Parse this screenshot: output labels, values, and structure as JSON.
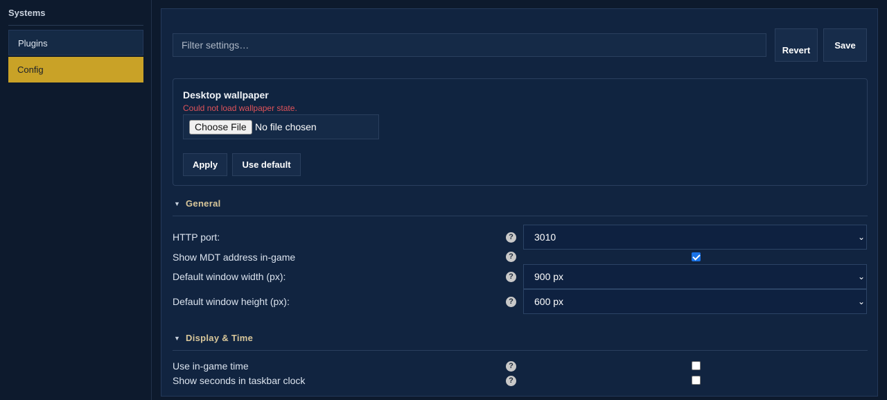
{
  "sidebar": {
    "title": "Systems",
    "items": [
      {
        "label": "Plugins",
        "active": false
      },
      {
        "label": "Config",
        "active": true
      }
    ]
  },
  "toolbar": {
    "filter_placeholder": "Filter settings…",
    "revert_label": "Revert",
    "save_label": "Save"
  },
  "wallpaper": {
    "title": "Desktop wallpaper",
    "error": "Could not load wallpaper state.",
    "choose_file_label": "Choose File",
    "no_file_text": "No file chosen",
    "apply_label": "Apply",
    "use_default_label": "Use default"
  },
  "sections": {
    "general": {
      "title": "General",
      "rows": [
        {
          "label": "HTTP port:",
          "type": "select",
          "value": "3010"
        },
        {
          "label": "Show MDT address in-game",
          "type": "checkbox",
          "checked": true
        },
        {
          "label": "Default window width (px):",
          "type": "select",
          "value": "900 px"
        },
        {
          "label": "Default window height (px):",
          "type": "select",
          "value": "600 px"
        }
      ]
    },
    "display": {
      "title": "Display & Time",
      "rows": [
        {
          "label": "Use in-game time",
          "type": "checkbox",
          "checked": false
        },
        {
          "label": "Show seconds in taskbar clock",
          "type": "checkbox",
          "checked": false
        }
      ]
    }
  },
  "icons": {
    "help": "?",
    "chevron": "⌄",
    "triangle": "▼"
  },
  "colors": {
    "accent": "#c9a227",
    "error": "#e0535a",
    "background": "#0d1a2d",
    "panel": "#112440"
  }
}
